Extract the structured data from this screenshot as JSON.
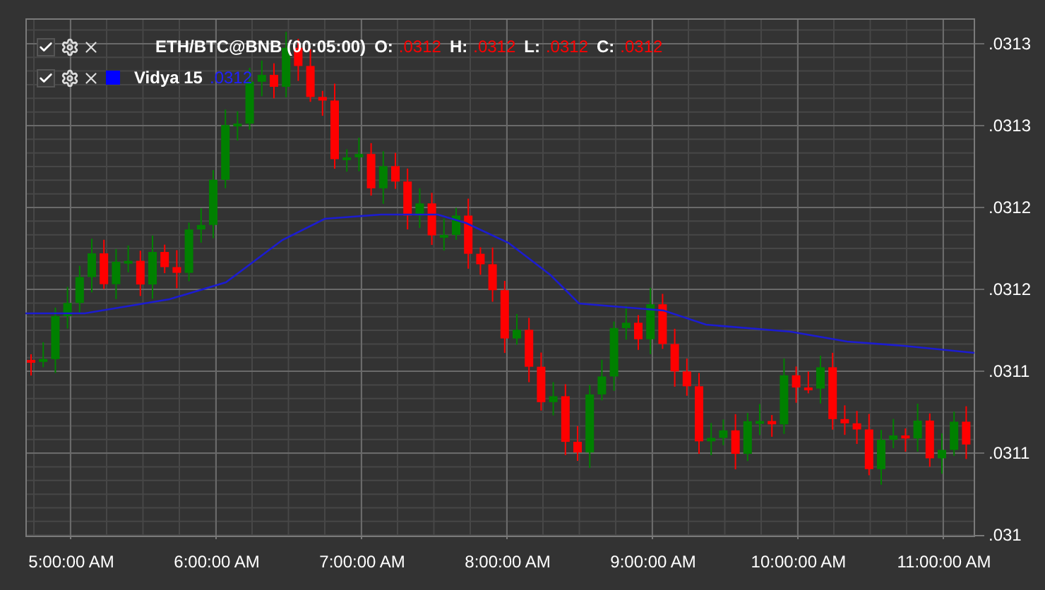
{
  "legend": [
    {
      "kind": "series",
      "checked": true,
      "label": "ETH/BTC@BNB (00:05:00)",
      "fields": [
        {
          "name": "O:",
          "value": ".0312"
        },
        {
          "name": "H:",
          "value": ".0312"
        },
        {
          "name": "L:",
          "value": ".0312"
        },
        {
          "name": "C:",
          "value": ".0312"
        }
      ]
    },
    {
      "kind": "indicator",
      "checked": true,
      "color": "#0000ff",
      "label": "Vidya 15",
      "value": ".0312"
    }
  ],
  "y_axis": {
    "ticks": [
      ".0313",
      ".0313",
      ".0312",
      ".0312",
      ".0311",
      ".0311",
      ".031"
    ]
  },
  "x_axis": {
    "ticks": [
      "5:00:00 AM",
      "6:00:00 AM",
      "7:00:00 AM",
      "8:00:00 AM",
      "9:00:00 AM",
      "10:00:00 AM",
      "11:00:00 AM"
    ]
  }
}
